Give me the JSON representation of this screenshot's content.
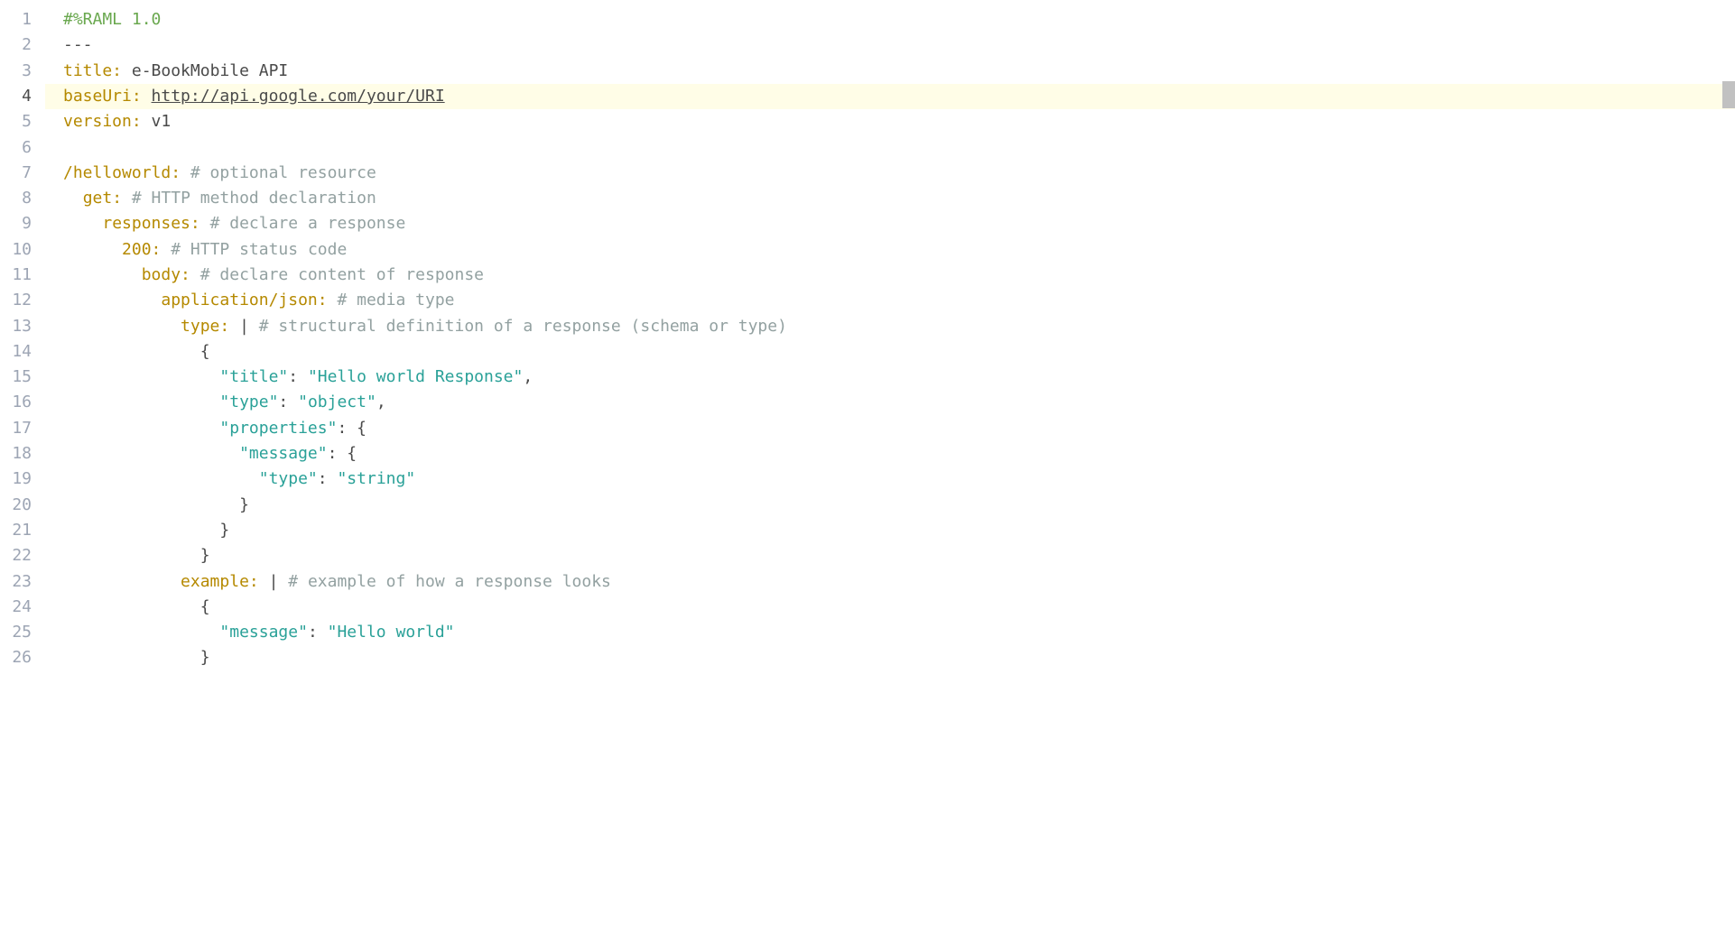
{
  "editor": {
    "activeLine": 4,
    "lines": [
      {
        "num": "1",
        "segments": [
          {
            "text": "#%RAML 1.0",
            "cls": "directive"
          }
        ]
      },
      {
        "num": "2",
        "segments": [
          {
            "text": "---",
            "cls": "punct"
          }
        ]
      },
      {
        "num": "3",
        "segments": [
          {
            "text": "title:",
            "cls": "key"
          },
          {
            "text": " e-BookMobile API",
            "cls": "value"
          }
        ]
      },
      {
        "num": "4",
        "highlighted": true,
        "segments": [
          {
            "text": "baseUri:",
            "cls": "key"
          },
          {
            "text": " ",
            "cls": "value"
          },
          {
            "text": "http://api.google.com/your/URI",
            "cls": "link"
          }
        ]
      },
      {
        "num": "5",
        "segments": [
          {
            "text": "version:",
            "cls": "key"
          },
          {
            "text": " v1",
            "cls": "value"
          }
        ]
      },
      {
        "num": "6",
        "segments": []
      },
      {
        "num": "7",
        "segments": [
          {
            "text": "/helloworld:",
            "cls": "resource"
          },
          {
            "text": " # optional resource",
            "cls": "comment"
          }
        ]
      },
      {
        "num": "8",
        "indent": 1,
        "segments": [
          {
            "text": "  ",
            "cls": ""
          },
          {
            "text": "get:",
            "cls": "key"
          },
          {
            "text": " # HTTP method declaration",
            "cls": "comment"
          }
        ]
      },
      {
        "num": "9",
        "indent": 2,
        "segments": [
          {
            "text": "    ",
            "cls": ""
          },
          {
            "text": "responses:",
            "cls": "key"
          },
          {
            "text": " # declare a response",
            "cls": "comment"
          }
        ]
      },
      {
        "num": "10",
        "indent": 3,
        "segments": [
          {
            "text": "      ",
            "cls": ""
          },
          {
            "text": "200:",
            "cls": "key"
          },
          {
            "text": " # HTTP status code",
            "cls": "comment"
          }
        ]
      },
      {
        "num": "11",
        "indent": 4,
        "segments": [
          {
            "text": "        ",
            "cls": ""
          },
          {
            "text": "body:",
            "cls": "key"
          },
          {
            "text": " # declare content of response",
            "cls": "comment"
          }
        ]
      },
      {
        "num": "12",
        "indent": 5,
        "segments": [
          {
            "text": "          ",
            "cls": ""
          },
          {
            "text": "application/json:",
            "cls": "key"
          },
          {
            "text": " # media type",
            "cls": "comment"
          }
        ]
      },
      {
        "num": "13",
        "indent": 6,
        "segments": [
          {
            "text": "            ",
            "cls": ""
          },
          {
            "text": "type:",
            "cls": "key"
          },
          {
            "text": " | ",
            "cls": "pipe"
          },
          {
            "text": "# structural definition of a response (schema or type)",
            "cls": "comment"
          }
        ]
      },
      {
        "num": "14",
        "indent": 7,
        "segments": [
          {
            "text": "              {",
            "cls": "punct"
          }
        ]
      },
      {
        "num": "15",
        "indent": 8,
        "segments": [
          {
            "text": "                ",
            "cls": ""
          },
          {
            "text": "\"title\"",
            "cls": "string"
          },
          {
            "text": ": ",
            "cls": "punct"
          },
          {
            "text": "\"Hello world Response\"",
            "cls": "string"
          },
          {
            "text": ",",
            "cls": "punct"
          }
        ]
      },
      {
        "num": "16",
        "indent": 8,
        "segments": [
          {
            "text": "                ",
            "cls": ""
          },
          {
            "text": "\"type\"",
            "cls": "string"
          },
          {
            "text": ": ",
            "cls": "punct"
          },
          {
            "text": "\"object\"",
            "cls": "string"
          },
          {
            "text": ",",
            "cls": "punct"
          }
        ]
      },
      {
        "num": "17",
        "indent": 8,
        "segments": [
          {
            "text": "                ",
            "cls": ""
          },
          {
            "text": "\"properties\"",
            "cls": "string"
          },
          {
            "text": ": {",
            "cls": "punct"
          }
        ]
      },
      {
        "num": "18",
        "indent": 9,
        "segments": [
          {
            "text": "                  ",
            "cls": ""
          },
          {
            "text": "\"message\"",
            "cls": "string"
          },
          {
            "text": ": {",
            "cls": "punct"
          }
        ]
      },
      {
        "num": "19",
        "indent": 10,
        "segments": [
          {
            "text": "                    ",
            "cls": ""
          },
          {
            "text": "\"type\"",
            "cls": "string"
          },
          {
            "text": ": ",
            "cls": "punct"
          },
          {
            "text": "\"string\"",
            "cls": "string"
          }
        ]
      },
      {
        "num": "20",
        "indent": 9,
        "segments": [
          {
            "text": "                  }",
            "cls": "punct"
          }
        ]
      },
      {
        "num": "21",
        "indent": 8,
        "segments": [
          {
            "text": "                }",
            "cls": "punct"
          }
        ]
      },
      {
        "num": "22",
        "indent": 7,
        "segments": [
          {
            "text": "              }",
            "cls": "punct"
          }
        ]
      },
      {
        "num": "23",
        "indent": 6,
        "segments": [
          {
            "text": "            ",
            "cls": ""
          },
          {
            "text": "example:",
            "cls": "key"
          },
          {
            "text": " | ",
            "cls": "pipe"
          },
          {
            "text": "# example of how a response looks",
            "cls": "comment"
          }
        ]
      },
      {
        "num": "24",
        "indent": 7,
        "segments": [
          {
            "text": "              {",
            "cls": "punct"
          }
        ]
      },
      {
        "num": "25",
        "indent": 8,
        "segments": [
          {
            "text": "                ",
            "cls": ""
          },
          {
            "text": "\"message\"",
            "cls": "string"
          },
          {
            "text": ": ",
            "cls": "punct"
          },
          {
            "text": "\"Hello world\"",
            "cls": "string"
          }
        ]
      },
      {
        "num": "26",
        "indent": 7,
        "segments": [
          {
            "text": "              }",
            "cls": "punct"
          }
        ]
      }
    ]
  }
}
